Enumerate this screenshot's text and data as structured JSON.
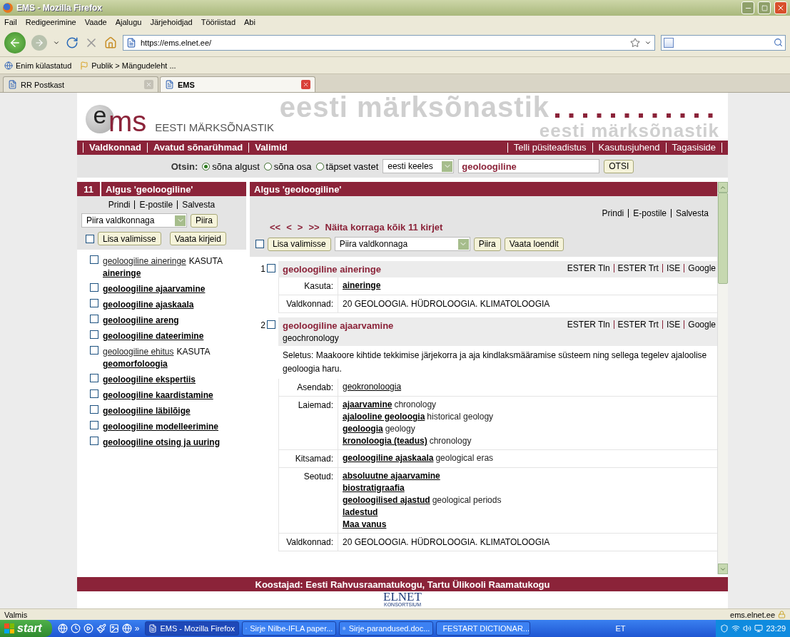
{
  "browser": {
    "title": "EMS - Mozilla Firefox",
    "menu": [
      "Fail",
      "Redigeerimine",
      "Vaade",
      "Ajalugu",
      "Järjehoidjad",
      "Tööriistad",
      "Abi"
    ],
    "url": "https://ems.elnet.ee/",
    "bookmarks": [
      "Enim külastatud",
      "Publik > Mängudeleht ..."
    ],
    "tabs": [
      {
        "label": "RR Postkast",
        "selected": false
      },
      {
        "label": "EMS",
        "selected": true
      }
    ]
  },
  "header": {
    "logo_parts": [
      "e",
      "ms"
    ],
    "site_name": "EESTI MÄRKSÕNASTIK",
    "banner_texts": [
      "eesti märksõnastik",
      "eesti märksõnastik"
    ]
  },
  "nav": {
    "left": [
      "Valdkonnad",
      "Avatud sõnarühmad",
      "Valimid"
    ],
    "right": [
      "Telli püsiteadistus",
      "Kasutusjuhend",
      "Tagasiside"
    ]
  },
  "search": {
    "label": "Otsin:",
    "modes": [
      {
        "label": "sõna algust",
        "selected": true
      },
      {
        "label": "sõna osa",
        "selected": false
      },
      {
        "label": "täpset vastet",
        "selected": false
      }
    ],
    "language": "eesti keeles",
    "value": "geoloogiline",
    "button": "OTSI"
  },
  "left_panel": {
    "count": "11",
    "title": "Algus 'geoloogiline'",
    "actions": [
      "Prindi",
      "E-postile",
      "Salvesta"
    ],
    "filter": "Piira valdkonnaga",
    "filter_button": "Piira",
    "select_all_checked": false,
    "add_button": "Lisa valimisse",
    "view_button": "Vaata kirjeid",
    "items": [
      {
        "kind": "reference",
        "term": "geoloogiline aineringe",
        "use_label": "KASUTA",
        "target": "aineringe",
        "checked": false
      },
      {
        "kind": "term",
        "term": "geoloogiline ajaarvamine",
        "checked": false
      },
      {
        "kind": "term",
        "term": "geoloogiline ajaskaala",
        "checked": false
      },
      {
        "kind": "term",
        "term": "geoloogiline areng",
        "checked": false
      },
      {
        "kind": "term",
        "term": "geoloogiline dateerimine",
        "checked": false
      },
      {
        "kind": "reference",
        "term": "geoloogiline ehitus",
        "use_label": "KASUTA",
        "target": "geomorfoloogia",
        "checked": false
      },
      {
        "kind": "term",
        "term": "geoloogiline ekspertiis",
        "checked": false
      },
      {
        "kind": "term",
        "term": "geoloogiline kaardistamine",
        "checked": false
      },
      {
        "kind": "term",
        "term": "geoloogiline läbilõige",
        "checked": false
      },
      {
        "kind": "term",
        "term": "geoloogiline modelleerimine",
        "checked": false
      },
      {
        "kind": "term",
        "term": "geoloogiline otsing ja uuring",
        "checked": false
      }
    ]
  },
  "right_panel": {
    "title": "Algus 'geoloogiline'",
    "actions": [
      "Prindi",
      "E-postile",
      "Salvesta"
    ],
    "pager": [
      "<<",
      "<",
      ">",
      ">>"
    ],
    "show_all": "Näita korraga kõik 11 kirjet",
    "select_all_checked": false,
    "add_button": "Lisa valimisse",
    "filter": "Piira valdkonnaga",
    "filter_button": "Piira",
    "view_button": "Vaata loendit",
    "entries": [
      {
        "number": "1",
        "checked": false,
        "heading": "geoloogiline aineringe",
        "links": [
          "ESTER Tln",
          "ESTER Trt",
          "ISE",
          "Google"
        ],
        "fields": [
          {
            "label": "Kasuta:",
            "kind": "terms",
            "terms": [
              {
                "term": "aineringe",
                "kind": "preferred"
              }
            ]
          },
          {
            "label": "Valdkonnad:",
            "kind": "text",
            "text": "20 GEOLOOGIA. HÜDROLOOGIA. KLIMATOLOOGIA"
          }
        ]
      },
      {
        "number": "2",
        "checked": false,
        "heading": "geoloogiline ajaarvamine",
        "translation": "geochronology",
        "links": [
          "ESTER Tln",
          "ESTER Trt",
          "ISE",
          "Google"
        ],
        "description": "Seletus: Maakoore kihtide tekkimise järjekorra ja aja kindlaksmääramise süsteem ning sellega tegelev ajaloolise geoloogia haru.",
        "fields": [
          {
            "label": "Asendab:",
            "kind": "terms",
            "terms": [
              {
                "term": "geokronoloogia",
                "kind": "nonpreferred"
              }
            ]
          },
          {
            "label": "Laiemad:",
            "kind": "terms",
            "terms": [
              {
                "term": "ajaarvamine",
                "kind": "preferred",
                "translation": "chronology"
              },
              {
                "term": "ajalooline geoloogia",
                "kind": "preferred",
                "translation": "historical geology"
              },
              {
                "term": "geoloogia",
                "kind": "preferred",
                "translation": "geology"
              },
              {
                "term": "kronoloogia (teadus)",
                "kind": "preferred",
                "translation": "chronology"
              }
            ]
          },
          {
            "label": "Kitsamad:",
            "kind": "terms",
            "terms": [
              {
                "term": "geoloogiline ajaskaala",
                "kind": "preferred",
                "translation": "geological eras"
              }
            ]
          },
          {
            "label": "Seotud:",
            "kind": "terms",
            "terms": [
              {
                "term": "absoluutne ajaarvamine",
                "kind": "preferred"
              },
              {
                "term": "biostratigraafia",
                "kind": "preferred"
              },
              {
                "term": "geoloogilised ajastud",
                "kind": "preferred",
                "translation": "geological periods"
              },
              {
                "term": "ladestud",
                "kind": "preferred"
              },
              {
                "term": "Maa vanus",
                "kind": "preferred"
              }
            ]
          },
          {
            "label": "Valdkonnad:",
            "kind": "text",
            "text": "20 GEOLOOGIA. HÜDROLOOGIA. KLIMATOLOOGIA"
          }
        ]
      }
    ]
  },
  "footer": {
    "credits": "Koostajad: Eesti Rahvusraamatukogu, Tartu Ülikooli Raamatukogu",
    "logo": "ELNET",
    "logo_sub": "KONSORTSIUM"
  },
  "status_bar": {
    "text": "Valmis",
    "domain": "ems.elnet.ee"
  },
  "taskbar": {
    "start": "start",
    "more": "»",
    "windows": [
      {
        "label": "EMS - Mozilla Firefox",
        "selected": true
      },
      {
        "label": "Sirje Nilbe-IFLA paper...",
        "selected": false
      },
      {
        "label": "Sirje-parandused.doc...",
        "selected": false
      },
      {
        "label": "FESTART DICTIONAR...",
        "selected": false
      }
    ],
    "language": "ET",
    "time": "23:29"
  }
}
